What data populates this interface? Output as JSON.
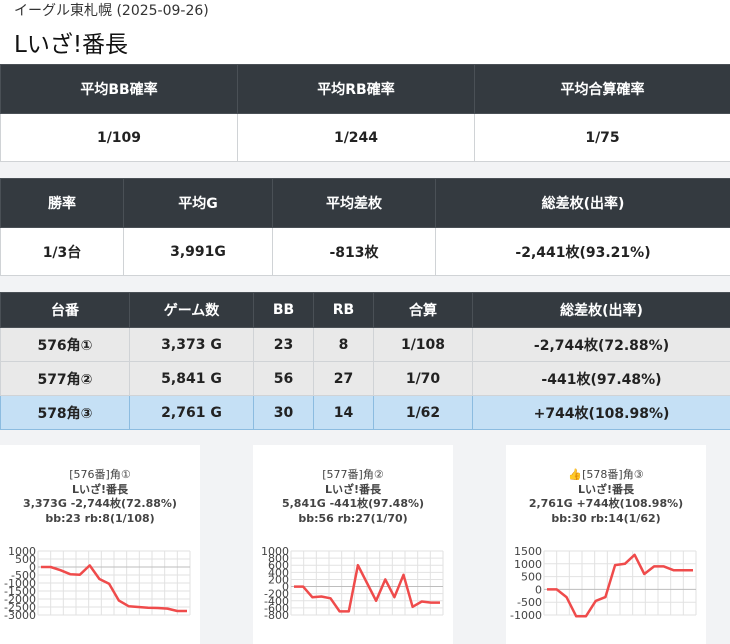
{
  "header": {
    "store": "イーグル東札幌 (2025-09-26)",
    "title": "Lいざ!番長"
  },
  "summary1": {
    "headers": [
      "平均BB確率",
      "平均RB確率",
      "平均合算確率"
    ],
    "values": [
      "1/109",
      "1/244",
      "1/75"
    ]
  },
  "summary2": {
    "headers": [
      "勝率",
      "平均G",
      "平均差枚",
      "総差枚(出率)"
    ],
    "values": [
      "1/3台",
      "3,991G",
      "-813枚",
      "-2,441枚(93.21%)"
    ]
  },
  "machines": {
    "headers": [
      "台番",
      "ゲーム数",
      "BB",
      "RB",
      "合算",
      "総差枚(出率)"
    ],
    "rows": [
      [
        "576角①",
        "3,373 G",
        "23",
        "8",
        "1/108",
        "-2,744枚(72.88%)"
      ],
      [
        "577角②",
        "5,841 G",
        "56",
        "27",
        "1/70",
        "-441枚(97.48%)"
      ],
      [
        "578角③",
        "2,761 G",
        "30",
        "14",
        "1/62",
        "+744枚(108.98%)"
      ]
    ]
  },
  "colors": {
    "header_bg": "#343a40",
    "highlight_row": "#c5e0f5",
    "line": "#ef4b4b"
  },
  "charts": [
    {
      "line1": "[576番]角①",
      "line2": "Lいざ!番長",
      "line3": "3,373G -2,744枚(72.88%)",
      "line4": "bb:23 rb:8(1/108)",
      "chart_data": {
        "type": "line",
        "yticks": [
          "1000",
          "500",
          "0",
          "-500",
          "-1000",
          "-1500",
          "-2000",
          "-2500",
          "-3000"
        ],
        "ylim": [
          -3000,
          1000
        ],
        "values": [
          0,
          0,
          -200,
          -450,
          -480,
          100,
          -750,
          -1050,
          -2100,
          -2450,
          -2500,
          -2550,
          -2560,
          -2600,
          -2750,
          -2750
        ]
      }
    },
    {
      "line1": "[577番]角②",
      "line2": "Lいざ!番長",
      "line3": "5,841G -441枚(97.48%)",
      "line4": "bb:56 rb:27(1/70)",
      "chart_data": {
        "type": "line",
        "yticks": [
          "1000",
          "800",
          "600",
          "400",
          "200",
          "0",
          "-200",
          "-400",
          "-600",
          "-800"
        ],
        "ylim": [
          -800,
          1000
        ],
        "values": [
          0,
          0,
          -300,
          -280,
          -330,
          -700,
          -700,
          600,
          100,
          -400,
          200,
          -300,
          330,
          -570,
          -420,
          -450,
          -450
        ]
      }
    },
    {
      "line1": "[578番]角③",
      "line2": "Lいざ!番長",
      "icon": "thumbs-up-icon",
      "line3": "2,761G +744枚(108.98%)",
      "line4": "bb:30 rb:14(1/62)",
      "chart_data": {
        "type": "line",
        "yticks": [
          "1500",
          "1000",
          "500",
          "0",
          "-500",
          "-1000"
        ],
        "ylim": [
          -1000,
          1500
        ],
        "values": [
          0,
          0,
          -300,
          -1050,
          -1050,
          -450,
          -300,
          950,
          1000,
          1350,
          600,
          900,
          900,
          750,
          750,
          750
        ]
      }
    }
  ]
}
